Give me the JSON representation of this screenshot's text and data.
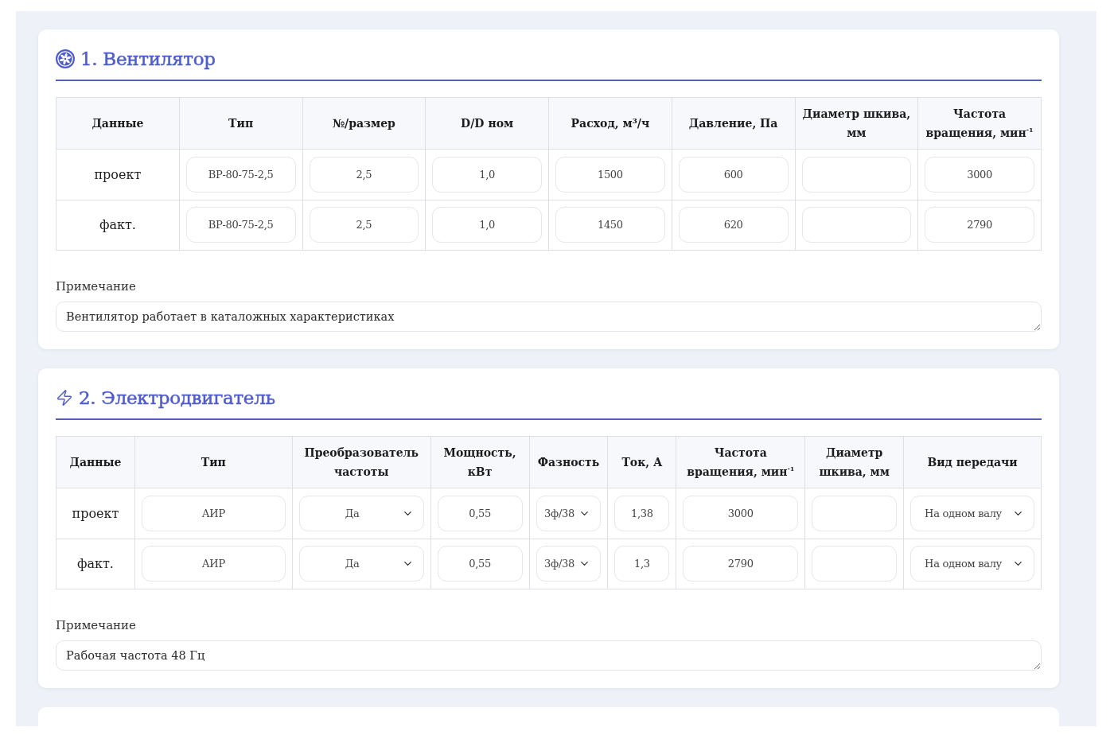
{
  "sections": [
    {
      "kind": "fan",
      "title": "1. Вентилятор",
      "table": {
        "columns": [
          "Данные",
          "Тип",
          "№/размер",
          "D/D ном",
          "Расход, м³/ч",
          "Давление, Па",
          "Диаметр шкива, мм",
          "Частота вращения, мин$^{-1}$"
        ],
        "rows": [
          {
            "cells": [
              {
                "kind": "label",
                "value": "проект"
              },
              {
                "kind": "input",
                "value": "ВР-80-75-2,5"
              },
              {
                "kind": "input",
                "value": "2,5"
              },
              {
                "kind": "input",
                "value": "1,0"
              },
              {
                "kind": "input",
                "value": "1500"
              },
              {
                "kind": "input",
                "value": "600"
              },
              {
                "kind": "input"
              },
              {
                "kind": "input",
                "value": "3000"
              }
            ]
          },
          {
            "cells": [
              {
                "kind": "label",
                "value": "факт."
              },
              {
                "kind": "input",
                "value": "ВР-80-75-2,5"
              },
              {
                "kind": "input",
                "value": "2,5"
              },
              {
                "kind": "input",
                "value": "1,0"
              },
              {
                "kind": "input",
                "value": "1450"
              },
              {
                "kind": "input",
                "value": "620"
              },
              {
                "kind": "input"
              },
              {
                "kind": "input",
                "value": "2790"
              }
            ]
          }
        ]
      },
      "note": {
        "label": "Примечание",
        "value": "Вентилятор работает в каталожных характеристиках"
      }
    },
    {
      "kind": "motor",
      "title": "2. Электродвигатель",
      "table": {
        "columns": [
          "Данные",
          "Тип",
          "Преобразователь частоты",
          "Мощность, кВт",
          "Фазность",
          "Ток, А",
          "Частота вращения, мин$^{-1}$",
          "Диаметр шкива, мм",
          "Вид передачи"
        ],
        "rows": [
          {
            "cells": [
              {
                "kind": "label",
                "value": "проект"
              },
              {
                "kind": "input",
                "value": "АИР"
              },
              {
                "kind": "select",
                "value": "Да"
              },
              {
                "kind": "input",
                "value": "0,55"
              },
              {
                "kind": "select",
                "value": "3ф/38"
              },
              {
                "kind": "input",
                "value": "1,38"
              },
              {
                "kind": "input",
                "value": "3000"
              },
              {
                "kind": "input"
              },
              {
                "kind": "select",
                "value": "На одном валу"
              }
            ]
          },
          {
            "cells": [
              {
                "kind": "label",
                "value": "факт."
              },
              {
                "kind": "input",
                "value": "АИР"
              },
              {
                "kind": "select",
                "value": "Да"
              },
              {
                "kind": "input",
                "value": "0,55"
              },
              {
                "kind": "select",
                "value": "3ф/38"
              },
              {
                "kind": "input",
                "value": "1,3"
              },
              {
                "kind": "input",
                "value": "2790"
              },
              {
                "kind": "input"
              },
              {
                "kind": "select",
                "value": "На одном валу"
              }
            ]
          }
        ]
      },
      "note": {
        "label": "Примечание",
        "value": "Рабочая частота 48 Гц"
      }
    }
  ]
}
